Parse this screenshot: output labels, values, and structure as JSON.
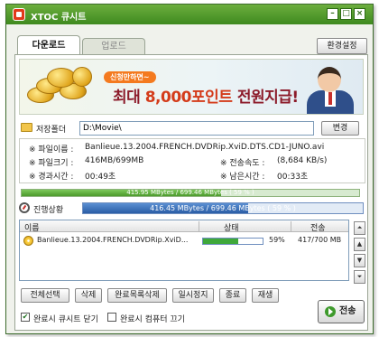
{
  "window": {
    "title": "XTOC 큐시트",
    "controls": {
      "minimize": "–",
      "maximize": "□",
      "close": "×"
    }
  },
  "tabs": {
    "active": "다운로드",
    "inactive": "업로드"
  },
  "settings_label": "환경설정",
  "banner": {
    "subtitle": "신청만하면~",
    "headline_a": "최대 ",
    "headline_highlight": "8,000포인트",
    "headline_b": " 전원지급!"
  },
  "folder": {
    "label": "저장폴더",
    "value": "D:\\Movie\\",
    "change_label": "변경"
  },
  "info": {
    "filename_label": "※ 파일이름 :",
    "filename": "Banlieue.13.2004.FRENCH.DVDRip.XviD.DTS.CD1-JUNO.avi",
    "filesize_label": "※ 파일크기 :",
    "filesize": "416MB/699MB",
    "speed_label": "※ 전송속도 :",
    "speed": "(8,684 KB/s)",
    "elapsed_label": "※ 경과시간 :",
    "elapsed": "00:49초",
    "remaining_label": "※ 남은시간 :",
    "remaining": "00:33초"
  },
  "overall_progress": {
    "text": "415.95 MBytes / 699.46 MBytes  ( 59 % )",
    "percent": 59
  },
  "current_progress": {
    "label": "진행상황",
    "text": "416.45 MBytes / 699.46 MBytes  ( 59 % )",
    "percent": 59
  },
  "list": {
    "headers": {
      "name": "이름",
      "status": "상태",
      "transfer": "전송"
    },
    "rows": [
      {
        "name": "Banlieue.13.2004.FRENCH.DVDRip.XviD...",
        "percent_text": "59%",
        "percent": 59,
        "size": "417/700 MB"
      }
    ]
  },
  "side_buttons": {
    "top": "⏶",
    "up": "▲",
    "down": "▼",
    "bottom": "⏷"
  },
  "actions": {
    "select_all": "전체선택",
    "delete": "삭제",
    "delete_completed": "완료목록삭제",
    "pause": "일시정지",
    "exit": "종료",
    "resume": "재생"
  },
  "checks": {
    "close_on_complete": {
      "label": "완료시 큐시트 닫기",
      "checked": true
    },
    "shutdown_on_complete": {
      "label": "완료시 컴퓨터 끄기",
      "checked": false
    }
  },
  "send_label": "전송",
  "colors": {
    "title_green": "#3f8a1f",
    "progress_green": "#4c9a2c",
    "progress_blue": "#2b5ea6"
  }
}
